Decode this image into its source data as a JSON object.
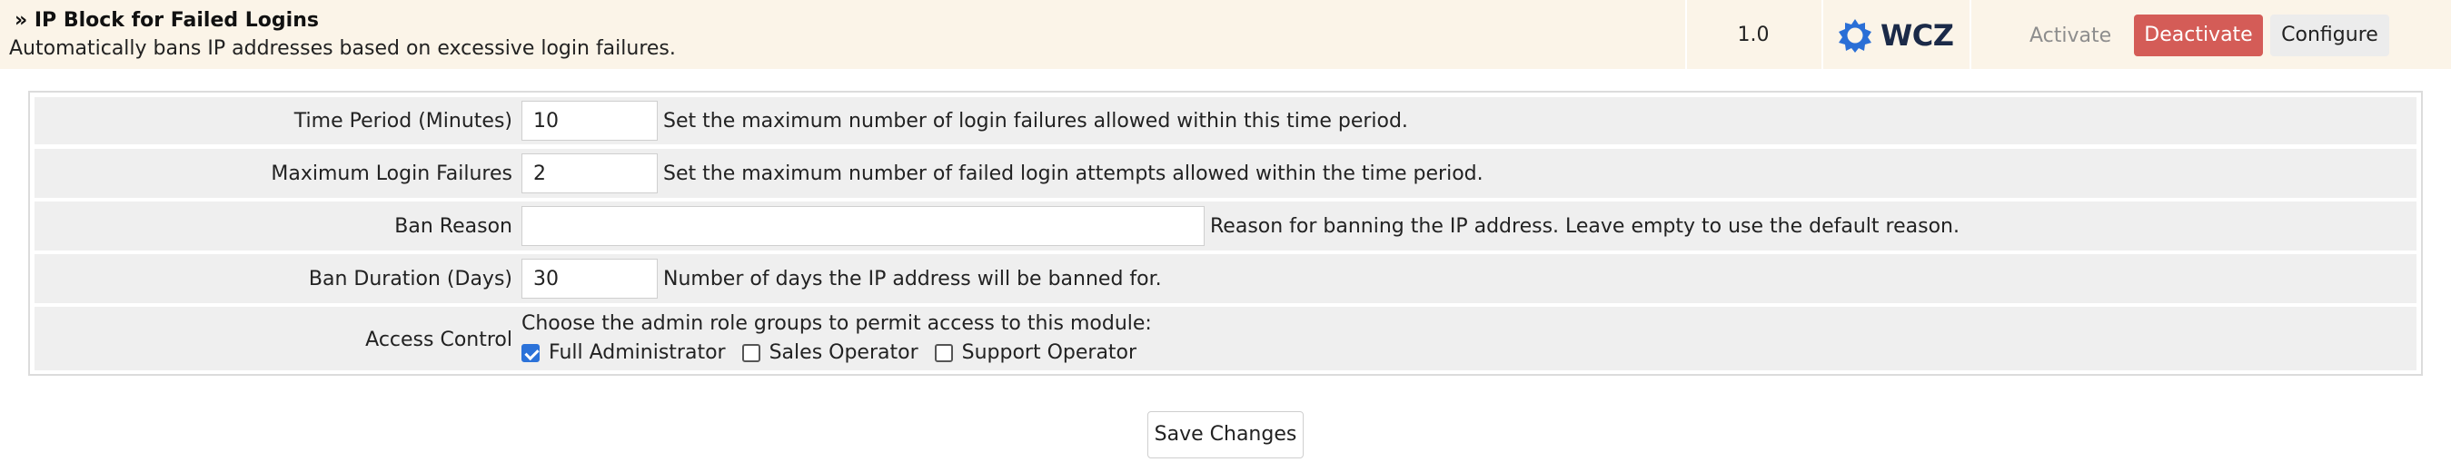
{
  "module": {
    "title": "» IP Block for Failed Logins",
    "description": "Automatically bans IP addresses based on excessive login failures.",
    "version": "1.0",
    "logo_text": "WCZ",
    "activate_label": "Activate",
    "deactivate_label": "Deactivate",
    "configure_label": "Configure"
  },
  "settings": {
    "time_period": {
      "label": "Time Period (Minutes)",
      "value": "10",
      "help": "Set the maximum number of login failures allowed within this time period."
    },
    "max_failures": {
      "label": "Maximum Login Failures",
      "value": "2",
      "help": "Set the maximum number of failed login attempts allowed within the time period."
    },
    "ban_reason": {
      "label": "Ban Reason",
      "value": "",
      "help": "Reason for banning the IP address. Leave empty to use the default reason."
    },
    "ban_duration": {
      "label": "Ban Duration (Days)",
      "value": "30",
      "help": "Number of days the IP address will be banned for."
    },
    "access_control": {
      "label": "Access Control",
      "help": "Choose the admin role groups to permit access to this module:",
      "options": [
        {
          "label": "Full Administrator",
          "checked": true
        },
        {
          "label": "Sales Operator",
          "checked": false
        },
        {
          "label": "Support Operator",
          "checked": false
        }
      ]
    }
  },
  "save_label": "Save Changes",
  "colors": {
    "header_bg": "#fbf4e8",
    "deactivate_bg": "#d45c57",
    "checkbox_checked": "#2b72d9",
    "row_bg": "#efefef"
  }
}
